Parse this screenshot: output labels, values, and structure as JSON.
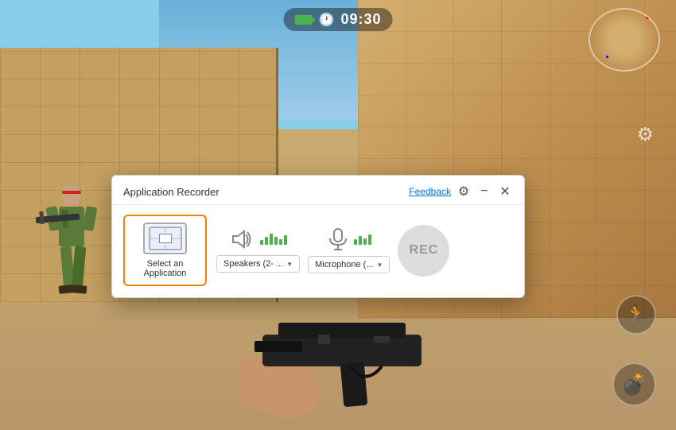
{
  "game": {
    "time": "09:30"
  },
  "dialog": {
    "title": "Application Recorder",
    "feedback_label": "Feedback",
    "select_app_label": "Select an Application",
    "speakers_label": "Speakers (2- ...",
    "microphone_label": "Microphone (... ",
    "rec_label": "REC",
    "settings_icon": "⚙",
    "minimize_icon": "−",
    "close_icon": "✕"
  }
}
